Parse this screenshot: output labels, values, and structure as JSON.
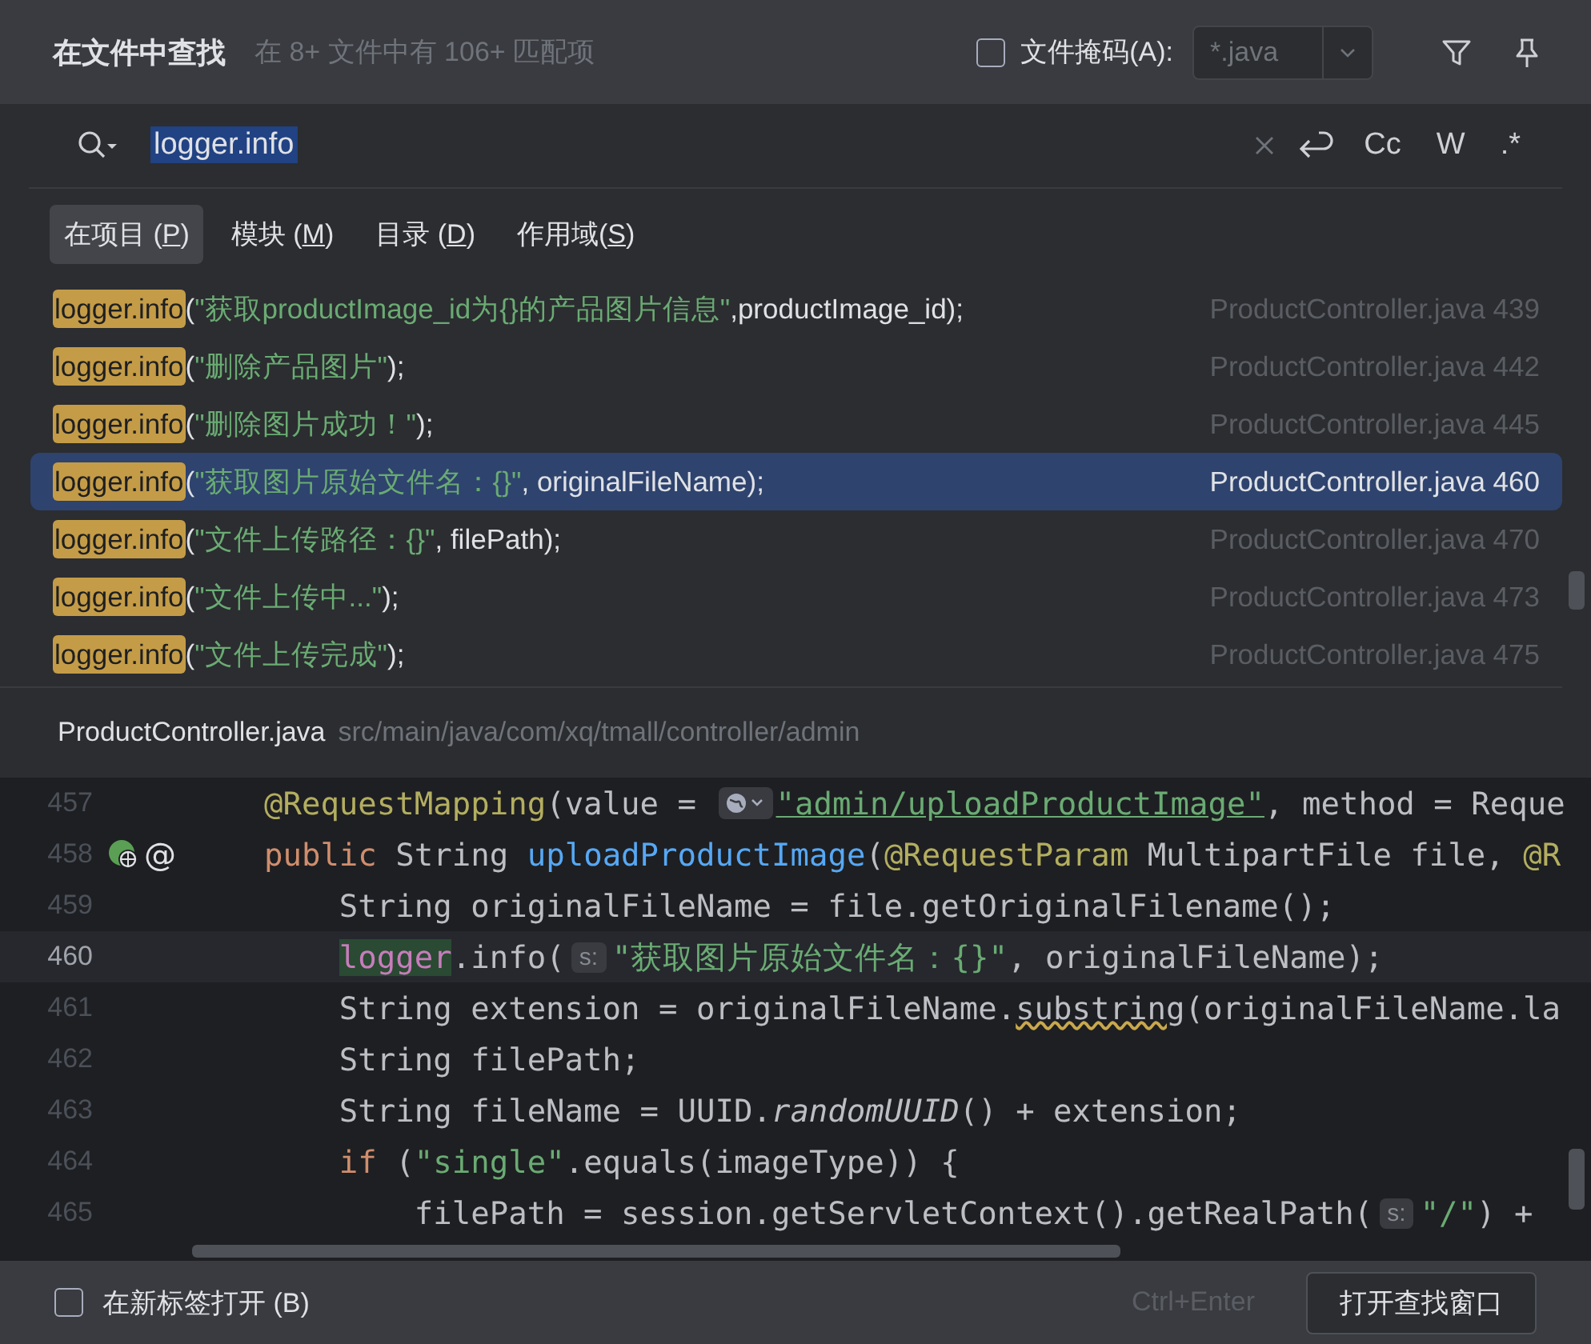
{
  "header": {
    "title": "在文件中查找",
    "subtitle": "在 8+ 文件中有 106+ 匹配项",
    "file_mask": {
      "label": "文件掩码(A):",
      "checked": false,
      "value": "*.java"
    }
  },
  "search": {
    "value": "logger.info",
    "options": [
      "Cc",
      "W",
      ".*"
    ]
  },
  "scope_tabs": [
    {
      "before": "在项目 (",
      "key": "P",
      "after": ")",
      "selected": true
    },
    {
      "before": "模块 (",
      "key": "M",
      "after": ")",
      "selected": false
    },
    {
      "before": "目录 (",
      "key": "D",
      "after": ")",
      "selected": false
    },
    {
      "before": "作用域(",
      "key": "S",
      "after": ")",
      "selected": false
    }
  ],
  "results": [
    {
      "tokens": [
        {
          "kind": "match",
          "text": "logger.info"
        },
        {
          "kind": "plain",
          "text": "("
        },
        {
          "kind": "str",
          "text": "\"获取productImage_id为{}的产品图片信息\""
        },
        {
          "kind": "plain",
          "text": ",productImage_id);"
        }
      ],
      "file": "ProductController.java",
      "line": "439",
      "selected": false
    },
    {
      "tokens": [
        {
          "kind": "match",
          "text": "logger.info"
        },
        {
          "kind": "plain",
          "text": "("
        },
        {
          "kind": "str",
          "text": "\"删除产品图片\""
        },
        {
          "kind": "plain",
          "text": ");"
        }
      ],
      "file": "ProductController.java",
      "line": "442",
      "selected": false
    },
    {
      "tokens": [
        {
          "kind": "match",
          "text": "logger.info"
        },
        {
          "kind": "plain",
          "text": "("
        },
        {
          "kind": "str",
          "text": "\"删除图片成功！\""
        },
        {
          "kind": "plain",
          "text": ");"
        }
      ],
      "file": "ProductController.java",
      "line": "445",
      "selected": false
    },
    {
      "tokens": [
        {
          "kind": "match",
          "text": "logger.info"
        },
        {
          "kind": "plain",
          "text": "("
        },
        {
          "kind": "str",
          "text": "\"获取图片原始文件名：{}\""
        },
        {
          "kind": "plain",
          "text": ", originalFileName);"
        }
      ],
      "file": "ProductController.java",
      "line": "460",
      "selected": true
    },
    {
      "tokens": [
        {
          "kind": "match",
          "text": "logger.info"
        },
        {
          "kind": "plain",
          "text": "("
        },
        {
          "kind": "str",
          "text": "\"文件上传路径：{}\""
        },
        {
          "kind": "plain",
          "text": ", filePath);"
        }
      ],
      "file": "ProductController.java",
      "line": "470",
      "selected": false
    },
    {
      "tokens": [
        {
          "kind": "match",
          "text": "logger.info"
        },
        {
          "kind": "plain",
          "text": "("
        },
        {
          "kind": "str",
          "text": "\"文件上传中...\""
        },
        {
          "kind": "plain",
          "text": ");"
        }
      ],
      "file": "ProductController.java",
      "line": "473",
      "selected": false
    },
    {
      "tokens": [
        {
          "kind": "match",
          "text": "logger.info"
        },
        {
          "kind": "plain",
          "text": "("
        },
        {
          "kind": "str",
          "text": "\"文件上传完成\""
        },
        {
          "kind": "plain",
          "text": ");"
        }
      ],
      "file": "ProductController.java",
      "line": "475",
      "selected": false
    }
  ],
  "preview": {
    "file": "ProductController.java",
    "path": "src/main/java/com/xq/tmall/controller/admin",
    "lines": [
      {
        "number": "457",
        "current": false,
        "tokens": [
          {
            "kind": "ann",
            "text": "    @RequestMapping"
          },
          {
            "kind": "plain",
            "text": "(value = "
          },
          {
            "kind": "url-hint"
          },
          {
            "kind": "link",
            "text": "\"admin/uploadProductImage\""
          },
          {
            "kind": "plain",
            "text": ", method = Reque"
          }
        ]
      },
      {
        "number": "458",
        "current": false,
        "gutter": "@",
        "tokens": [
          {
            "kind": "kw",
            "text": "    public"
          },
          {
            "kind": "plain",
            "text": " String "
          },
          {
            "kind": "fn",
            "text": "uploadProductImage"
          },
          {
            "kind": "plain",
            "text": "("
          },
          {
            "kind": "ann",
            "text": "@RequestParam"
          },
          {
            "kind": "plain",
            "text": " MultipartFile file, "
          },
          {
            "kind": "ann",
            "text": "@R"
          }
        ]
      },
      {
        "number": "459",
        "current": false,
        "tokens": [
          {
            "kind": "plain",
            "text": "        String originalFileName = file.getOriginalFilename();"
          }
        ]
      },
      {
        "number": "460",
        "current": true,
        "tokens": [
          {
            "kind": "field",
            "text": "        logger"
          },
          {
            "kind": "plain",
            "text": ".info("
          },
          {
            "kind": "hint",
            "text": "s:"
          },
          {
            "kind": "str",
            "text": "\"获取图片原始文件名：{}\""
          },
          {
            "kind": "plain",
            "text": ", originalFileName);"
          }
        ]
      },
      {
        "number": "461",
        "current": false,
        "tokens": [
          {
            "kind": "plain",
            "text": "        String extension = originalFileName."
          },
          {
            "kind": "warn",
            "text": "substring"
          },
          {
            "kind": "plain",
            "text": "(originalFileName.la"
          }
        ]
      },
      {
        "number": "462",
        "current": false,
        "tokens": [
          {
            "kind": "plain",
            "text": "        String filePath;"
          }
        ]
      },
      {
        "number": "463",
        "current": false,
        "tokens": [
          {
            "kind": "plain",
            "text": "        String fileName = UUID."
          },
          {
            "kind": "italic",
            "text": "randomUUID"
          },
          {
            "kind": "plain",
            "text": "() + extension;"
          }
        ]
      },
      {
        "number": "464",
        "current": false,
        "tokens": [
          {
            "kind": "kw",
            "text": "        if"
          },
          {
            "kind": "plain",
            "text": " ("
          },
          {
            "kind": "str",
            "text": "\"single\""
          },
          {
            "kind": "plain",
            "text": ".equals(imageType)) {"
          }
        ]
      },
      {
        "number": "465",
        "current": false,
        "tokens": [
          {
            "kind": "plain",
            "text": "            filePath = session.getServletContext().getRealPath("
          },
          {
            "kind": "hint",
            "text": "s:"
          },
          {
            "kind": "str",
            "text": "\"/\""
          },
          {
            "kind": "plain",
            "text": ") + "
          }
        ]
      }
    ]
  },
  "footer": {
    "new_tab": {
      "label": "在新标签打开 (B)",
      "checked": false
    },
    "shortcut": "Ctrl+Enter",
    "button": "打开查找窗口"
  }
}
